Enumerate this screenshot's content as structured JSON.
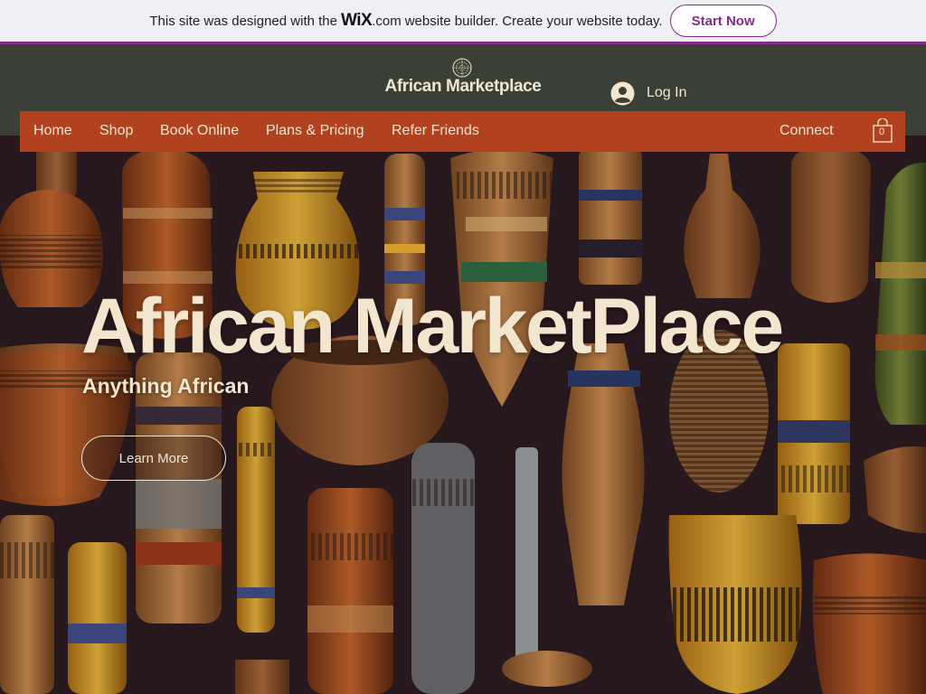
{
  "wix_banner": {
    "text_before": "This site was designed with the",
    "logo": "WiX",
    "logo_suffix": ".com",
    "text_after": "website builder. Create your website today.",
    "button_label": "Start Now"
  },
  "header": {
    "logo_icon": "globe-logo-icon",
    "site_title": "African Marketplace",
    "login_label": "Log In",
    "login_icon": "account-icon"
  },
  "nav": {
    "items": [
      {
        "label": "Home"
      },
      {
        "label": "Shop"
      },
      {
        "label": "Book Online"
      },
      {
        "label": "Plans & Pricing"
      },
      {
        "label": "Refer Friends"
      }
    ],
    "connect_label": "Connect",
    "cart_count": "0",
    "cart_icon": "shopping-bag-icon"
  },
  "hero": {
    "title": "African MarketPlace",
    "subtitle": "Anything African",
    "button_label": "Learn More"
  },
  "colors": {
    "banner_bg": "#eef0f3",
    "accent_purple": "#8a2a8e",
    "header_bg": "#3b4036",
    "nav_bg": "#b24120",
    "text_cream": "#f2e6cf",
    "hero_bg": "#2a1a1f"
  }
}
